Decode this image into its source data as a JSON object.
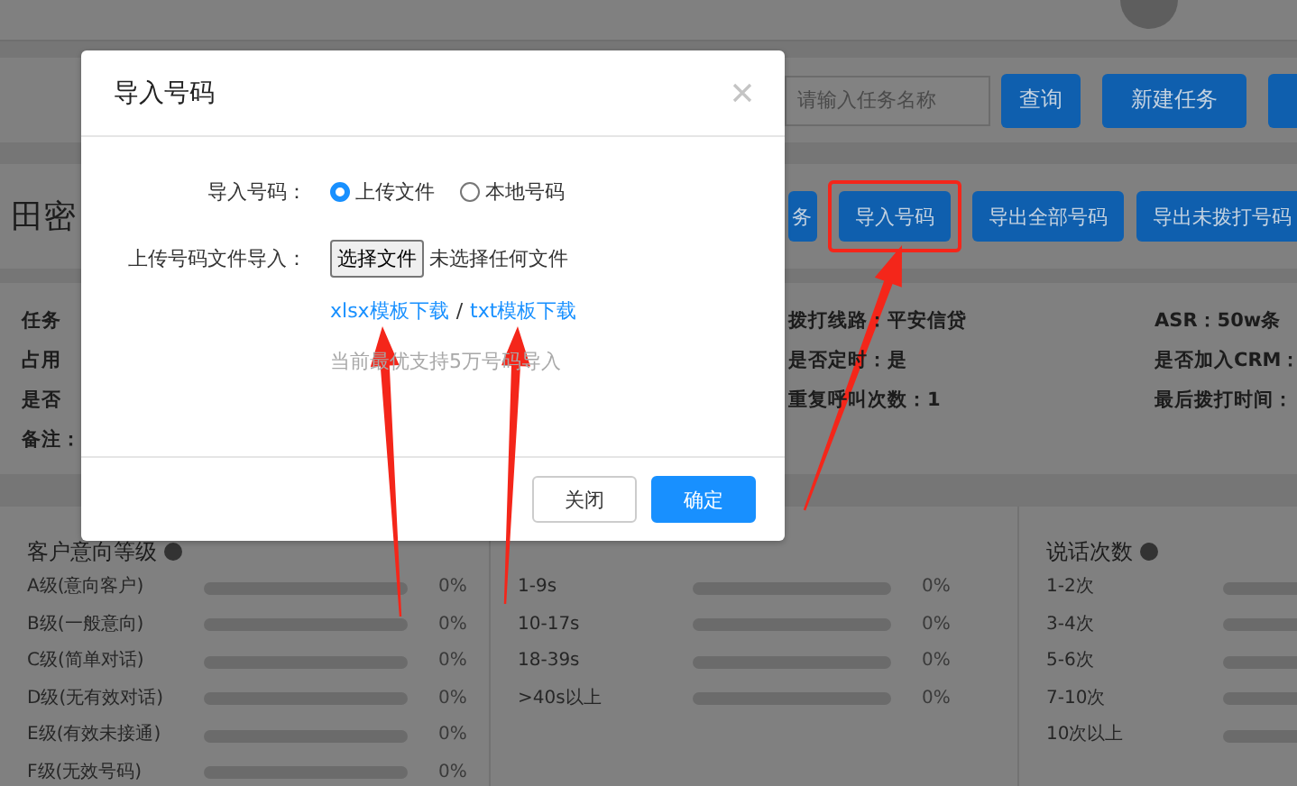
{
  "toolbar": {
    "search": {
      "placeholder": "请输入任务名称"
    },
    "buttons": [
      "查询",
      "新建任务"
    ]
  },
  "task": {
    "title": "田密",
    "actions": [
      {
        "label": "务"
      },
      {
        "label": "导入号码",
        "highlighted": true
      },
      {
        "label": "导出全部号码"
      },
      {
        "label": "导出未拨打号码"
      }
    ]
  },
  "info": {
    "columns": [
      [
        "任务",
        "占用",
        "是否",
        "备注："
      ],
      [
        "拨打线路：平安信贷",
        "是否定时：是",
        "重复呼叫次数：1"
      ],
      [
        "ASR：50w条",
        "是否加入CRM：",
        "最后拨打时间："
      ]
    ]
  },
  "stats": [
    {
      "title": "客户意向等级",
      "rows": [
        {
          "label": "A级(意向客户)",
          "level": 0,
          "reading": "0%"
        },
        {
          "label": "B级(一般意向)",
          "level": 0,
          "reading": "0%"
        },
        {
          "label": "C级(简单对话)",
          "level": 0,
          "reading": "0%"
        },
        {
          "label": "D级(无有效对话)",
          "level": 0,
          "reading": "0%"
        },
        {
          "label": "E级(有效未接通)",
          "level": 0,
          "reading": "0%"
        },
        {
          "label": "F级(无效号码)",
          "level": 0,
          "reading": "0%"
        }
      ]
    },
    {
      "rows": [
        {
          "label": "1-9s",
          "level": 0,
          "reading": "0%"
        },
        {
          "label": "10-17s",
          "level": 0,
          "reading": "0%"
        },
        {
          "label": "18-39s",
          "level": 0,
          "reading": "0%"
        },
        {
          "label": ">40s以上",
          "level": 0,
          "reading": "0%"
        }
      ]
    },
    {
      "title": "说话次数",
      "rows": [
        {
          "label": "1-2次",
          "level": 0
        },
        {
          "label": "3-4次",
          "level": 0
        },
        {
          "label": "5-6次",
          "level": 0
        },
        {
          "label": "7-10次",
          "level": 0
        },
        {
          "label": "10次以上",
          "level": 0
        }
      ]
    }
  ],
  "dialog": {
    "title": "导入号码",
    "fields": [
      {
        "kind": "radio",
        "label": "导入号码：",
        "options": [
          {
            "label": "上传文件",
            "selected": true
          },
          {
            "label": "本地号码",
            "selected": false
          }
        ]
      },
      {
        "kind": "file",
        "label": "上传号码文件导入：",
        "button": "选择文件",
        "status": "未选择任何文件"
      }
    ],
    "links": [
      "xlsx模板下载",
      "txt模板下载"
    ],
    "separator": "/",
    "hint": "当前最优支持5万号码导入",
    "buttons": [
      {
        "label": "关闭",
        "primary": false
      },
      {
        "label": "确定",
        "primary": true
      }
    ]
  }
}
